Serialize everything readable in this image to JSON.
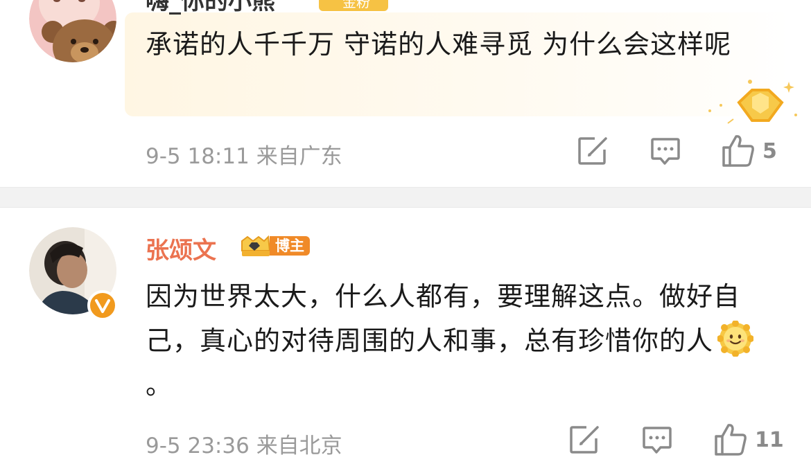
{
  "comments": [
    {
      "username": "嗨_你的小熊",
      "badge_label": "金粉",
      "text": "承诺的人千千万 守诺的人难寻觅 为什么会这样呢",
      "timestamp": "9-5 18:11",
      "location": "来自广东",
      "likes": "5"
    },
    {
      "username": "张颂文",
      "badge_label": "博主",
      "text_before_emoji": "因为世界太大，什么人都有，要理解这点。做好自己，真心的对待周围的人和事，总有珍惜你的人",
      "text_after_emoji": "。",
      "emoji": "smiling-sun-emoji",
      "timestamp": "9-5 23:36",
      "location": "来自北京",
      "likes": "11",
      "verified": true
    }
  ],
  "colors": {
    "username_blogger": "#eb7350",
    "meta_text": "#9a9a9a",
    "separator": "#f2f2f2",
    "verified_orange": "#f19a1e"
  },
  "icons": {
    "share": "edit-share-icon",
    "reply": "comment-bubble-icon",
    "like": "thumbs-up-icon"
  }
}
